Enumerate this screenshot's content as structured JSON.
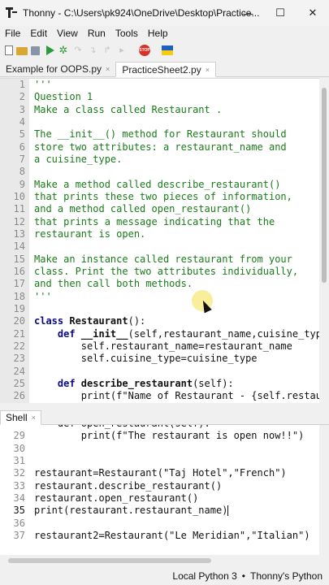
{
  "window": {
    "title": "Thonny  -  C:\\Users\\pk924\\OneDrive\\Desktop\\Practice...",
    "minimize": "—",
    "maximize": "☐",
    "close": "✕"
  },
  "menu": [
    "File",
    "Edit",
    "View",
    "Run",
    "Tools",
    "Help"
  ],
  "toolbar": {
    "icons": [
      "new-file-icon",
      "open-folder-icon",
      "save-icon",
      "run-icon",
      "debug-icon",
      "step-over-icon",
      "step-into-icon",
      "step-out-icon",
      "resume-icon",
      "stop-icon",
      "ukraine-flag-icon"
    ],
    "stop_label": "STOP"
  },
  "editor_tabs": [
    {
      "label": "Example for OOPS.py",
      "close": "×",
      "active": false
    },
    {
      "label": "PracticeSheet2.py",
      "close": "×",
      "active": true
    }
  ],
  "editor": {
    "lines": [
      {
        "n": "1",
        "text": "'''",
        "style": "str"
      },
      {
        "n": "2",
        "text": "Question 1",
        "style": "str"
      },
      {
        "n": "3",
        "text": "Make a class called Restaurant .",
        "style": "str"
      },
      {
        "n": "4",
        "text": "",
        "style": "str"
      },
      {
        "n": "5",
        "text": "The __init__() method for Restaurant should",
        "style": "str"
      },
      {
        "n": "6",
        "text": "store two attributes: a restaurant_name and",
        "style": "str"
      },
      {
        "n": "7",
        "text": "a cuisine_type.",
        "style": "str"
      },
      {
        "n": "8",
        "text": "",
        "style": "str"
      },
      {
        "n": "9",
        "text": "Make a method called describe_restaurant()",
        "style": "str"
      },
      {
        "n": "10",
        "text": "that prints these two pieces of information,",
        "style": "str"
      },
      {
        "n": "11",
        "text": "and a method called open_restaurant()",
        "style": "str"
      },
      {
        "n": "12",
        "text": "that prints a message indicating that the",
        "style": "str"
      },
      {
        "n": "13",
        "text": "restaurant is open.",
        "style": "str"
      },
      {
        "n": "14",
        "text": "",
        "style": "str"
      },
      {
        "n": "15",
        "text": "Make an instance called restaurant from your",
        "style": "str"
      },
      {
        "n": "16",
        "text": "class. Print the two attributes individually,",
        "style": "str"
      },
      {
        "n": "17",
        "text": "and then call both methods.",
        "style": "str"
      },
      {
        "n": "18",
        "text": "'''",
        "style": "str"
      },
      {
        "n": "19",
        "text": "",
        "style": "plain"
      },
      {
        "n": "20",
        "kw": "class ",
        "fn": "Restaurant",
        "text": "():",
        "style": "plain"
      },
      {
        "n": "21",
        "kw": "    def ",
        "fn": "__init__",
        "text": "(self,restaurant_name,cuisine_type):",
        "style": "plain"
      },
      {
        "n": "22",
        "text": "        self.restaurant_name=restaurant_name",
        "style": "plain"
      },
      {
        "n": "23",
        "text": "        self.cuisine_type=cuisine_type",
        "style": "plain"
      },
      {
        "n": "24",
        "text": "",
        "style": "plain"
      },
      {
        "n": "25",
        "kw": "    def ",
        "fn": "describe_restaurant",
        "text": "(self):",
        "style": "plain"
      },
      {
        "n": "26",
        "text": "        print(f\"Name of Restaurant - {self.restaurant_name}\")",
        "style": "plain"
      }
    ]
  },
  "shell_tab": {
    "label": "Shell",
    "close": "×"
  },
  "shell": {
    "lines": [
      {
        "n": "",
        "text": "    def open_restaurant(self):",
        "style": "plain"
      },
      {
        "n": "29",
        "text": "        print(f\"The restaurant is open now!!\")",
        "style": "plain"
      },
      {
        "n": "30",
        "text": "",
        "style": "plain"
      },
      {
        "n": "31",
        "text": "",
        "style": "plain"
      },
      {
        "n": "32",
        "text": "restaurant=Restaurant(\"Taj Hotel\",\"French\")",
        "style": "plain"
      },
      {
        "n": "33",
        "text": "restaurant.describe_restaurant()",
        "style": "plain"
      },
      {
        "n": "34",
        "text": "restaurant.open_restaurant()",
        "style": "plain"
      },
      {
        "n": "35",
        "text": "print(restaurant.restaurant_name)",
        "style": "plain",
        "current": true
      },
      {
        "n": "36",
        "text": "",
        "style": "plain"
      },
      {
        "n": "37",
        "text": "restaurant2=Restaurant(\"Le Meridian\",\"Italian\")",
        "style": "plain"
      }
    ]
  },
  "status": {
    "interpreter": "Local Python 3",
    "separator": "•",
    "app": "Thonny's Python"
  }
}
